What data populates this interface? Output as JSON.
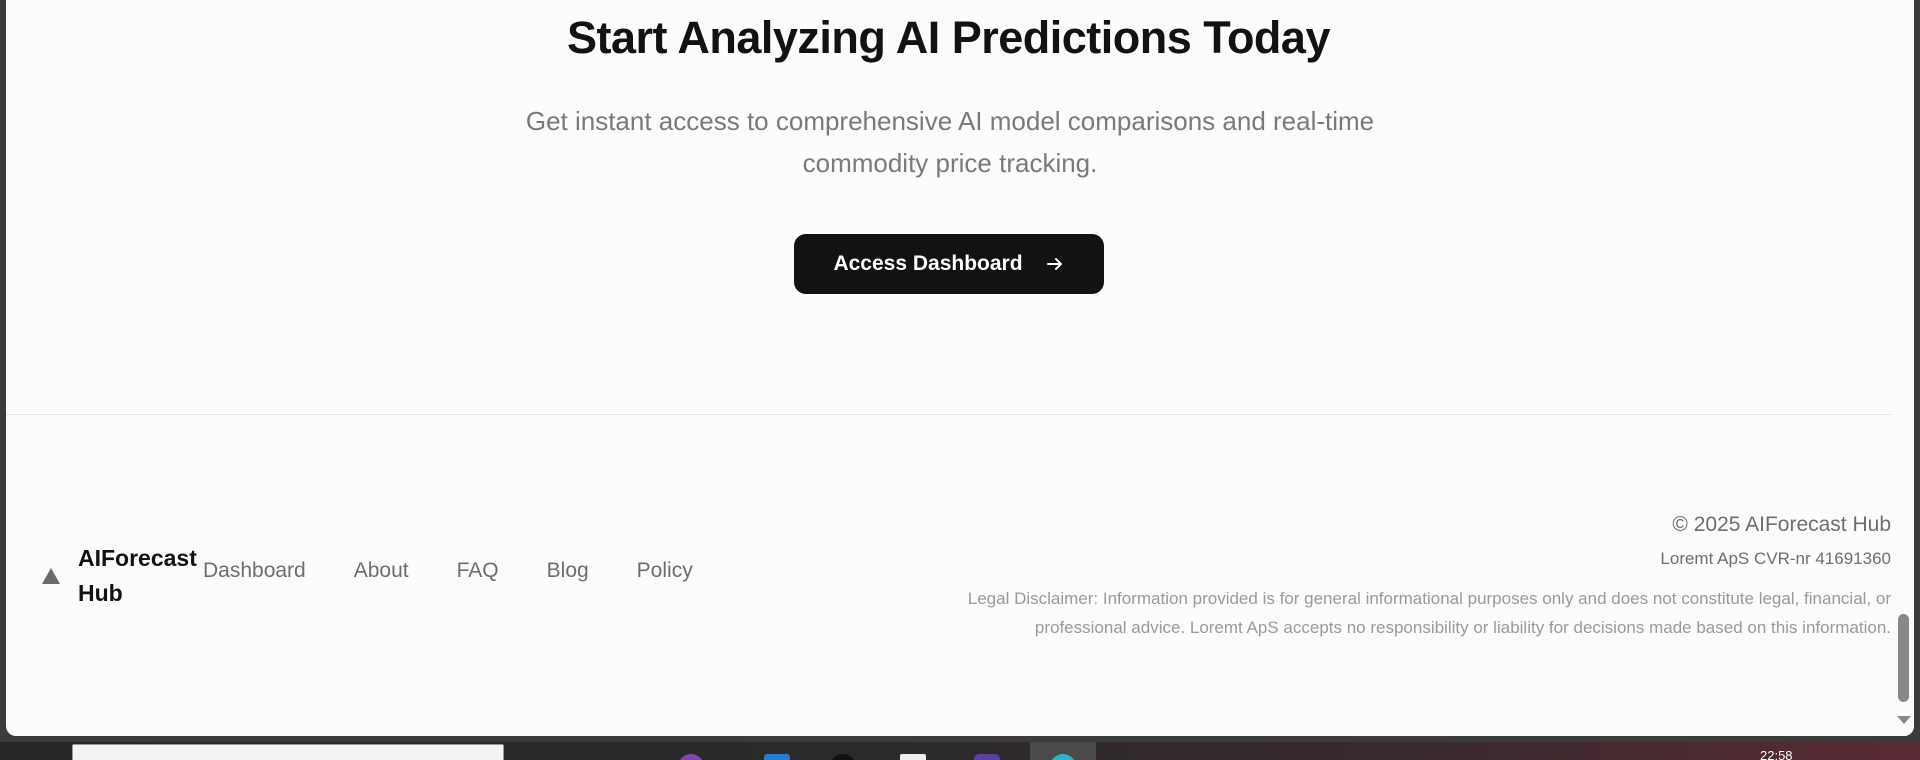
{
  "cta": {
    "title": "Start Analyzing AI Predictions Today",
    "subtitle": "Get instant access to comprehensive AI model comparisons and real-time commodity price tracking.",
    "button_label": "Access Dashboard"
  },
  "footer": {
    "brand": "AIForecast Hub",
    "nav": [
      "Dashboard",
      "About",
      "FAQ",
      "Blog",
      "Policy"
    ],
    "copyright": "© 2025 AIForecast Hub",
    "company": "Loremt ApS CVR-nr 41691360",
    "disclaimer": "Legal Disclaimer: Information provided is for general informational purposes only and does not constitute legal, financial, or professional advice. Loremt ApS accepts no responsibility or liability for decisions made based on this information."
  },
  "taskbar": {
    "clock": "22:58"
  },
  "colors": {
    "button_bg": "#121212",
    "page_bg": "#fcfcfc",
    "muted_text": "#7a7a7a"
  }
}
